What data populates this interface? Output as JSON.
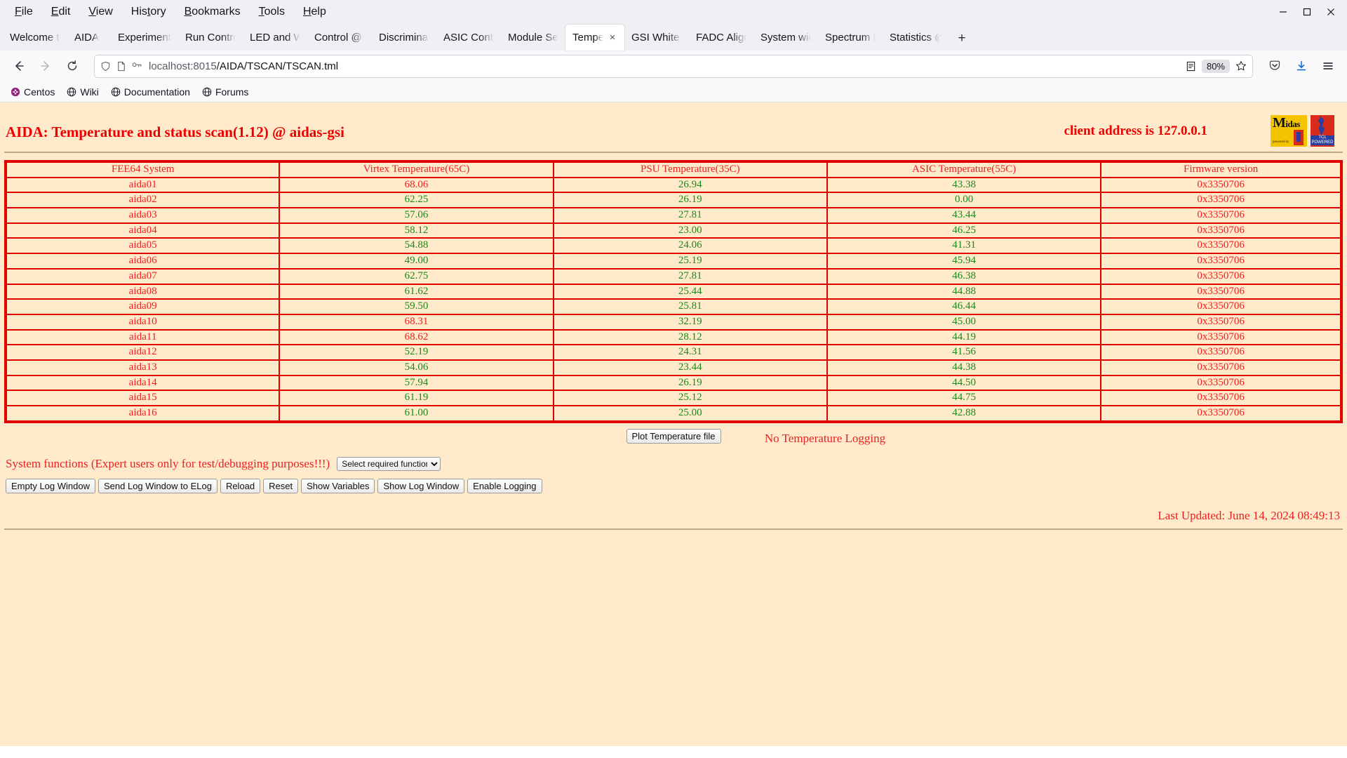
{
  "browser": {
    "menus": [
      "File",
      "Edit",
      "View",
      "History",
      "Bookmarks",
      "Tools",
      "Help"
    ],
    "window_controls": {
      "minimize": "—",
      "maximize": "☐",
      "close": "✕"
    },
    "tabs": [
      {
        "label": "Welcome to Cen",
        "active": false
      },
      {
        "label": "AIDA",
        "active": false
      },
      {
        "label": "Experiment Cont",
        "active": false
      },
      {
        "label": "Run Control @ a",
        "active": false
      },
      {
        "label": "LED and Wavefo",
        "active": false
      },
      {
        "label": "Control @ aidas",
        "active": false
      },
      {
        "label": "Discriminator co",
        "active": false
      },
      {
        "label": "ASIC Control @",
        "active": false
      },
      {
        "label": "Module Settings",
        "active": false
      },
      {
        "label": "Temperature a",
        "active": true
      },
      {
        "label": "GSI White Rabbi",
        "active": false
      },
      {
        "label": "FADC Align & Co",
        "active": false
      },
      {
        "label": "System wide Ch",
        "active": false
      },
      {
        "label": "Spectrum Brows",
        "active": false
      },
      {
        "label": "Statistics @ aid",
        "active": false
      }
    ],
    "new_tab_label": "+",
    "nav": {
      "back": "←",
      "forward": "→",
      "reload": "↻"
    },
    "url": {
      "host": "localhost:8015",
      "path": "/AIDA/TSCAN/TSCAN.tml"
    },
    "zoom_level": "80%",
    "bookmarks": [
      {
        "label": "Centos",
        "icon": "centos-icon"
      },
      {
        "label": "Wiki",
        "icon": "globe-icon"
      },
      {
        "label": "Documentation",
        "icon": "globe-icon"
      },
      {
        "label": "Forums",
        "icon": "globe-icon"
      }
    ]
  },
  "page": {
    "title": "AIDA: Temperature and status scan(1.12) @ aidas-gsi",
    "client_address": "client address is 127.0.0.1",
    "logos": {
      "midas": {
        "m": "M",
        "rest": "idas",
        "sub": "powered by"
      },
      "tcl": {
        "band": "TCL\nPOWERED",
        "line1": "TCL",
        "line2": "POWERED"
      }
    },
    "colors": {
      "background": "#ffeacb",
      "alert": "#ef2020",
      "ok": "#1a8a1a",
      "border": "#e00000"
    },
    "table": {
      "headers": [
        "FEE64 System",
        "Virtex Temperature(65C)",
        "PSU Temperature(35C)",
        "ASIC Temperature(55C)",
        "Firmware version"
      ],
      "rows": [
        {
          "system": "aida01",
          "virtex": "68.06",
          "virtex_hot": true,
          "psu": "26.94",
          "psu_hot": false,
          "asic": "43.38",
          "asic_hot": false,
          "firmware": "0x3350706"
        },
        {
          "system": "aida02",
          "virtex": "62.25",
          "virtex_hot": false,
          "psu": "26.19",
          "psu_hot": false,
          "asic": "0.00",
          "asic_hot": false,
          "firmware": "0x3350706"
        },
        {
          "system": "aida03",
          "virtex": "57.06",
          "virtex_hot": false,
          "psu": "27.81",
          "psu_hot": false,
          "asic": "43.44",
          "asic_hot": false,
          "firmware": "0x3350706"
        },
        {
          "system": "aida04",
          "virtex": "58.12",
          "virtex_hot": false,
          "psu": "23.00",
          "psu_hot": false,
          "asic": "46.25",
          "asic_hot": false,
          "firmware": "0x3350706"
        },
        {
          "system": "aida05",
          "virtex": "54.88",
          "virtex_hot": false,
          "psu": "24.06",
          "psu_hot": false,
          "asic": "41.31",
          "asic_hot": false,
          "firmware": "0x3350706"
        },
        {
          "system": "aida06",
          "virtex": "49.00",
          "virtex_hot": false,
          "psu": "25.19",
          "psu_hot": false,
          "asic": "45.94",
          "asic_hot": false,
          "firmware": "0x3350706"
        },
        {
          "system": "aida07",
          "virtex": "62.75",
          "virtex_hot": false,
          "psu": "27.81",
          "psu_hot": false,
          "asic": "46.38",
          "asic_hot": false,
          "firmware": "0x3350706"
        },
        {
          "system": "aida08",
          "virtex": "61.62",
          "virtex_hot": false,
          "psu": "25.44",
          "psu_hot": false,
          "asic": "44.88",
          "asic_hot": false,
          "firmware": "0x3350706"
        },
        {
          "system": "aida09",
          "virtex": "59.50",
          "virtex_hot": false,
          "psu": "25.81",
          "psu_hot": false,
          "asic": "46.44",
          "asic_hot": false,
          "firmware": "0x3350706"
        },
        {
          "system": "aida10",
          "virtex": "68.31",
          "virtex_hot": true,
          "psu": "32.19",
          "psu_hot": false,
          "asic": "45.00",
          "asic_hot": false,
          "firmware": "0x3350706"
        },
        {
          "system": "aida11",
          "virtex": "68.62",
          "virtex_hot": true,
          "psu": "28.12",
          "psu_hot": false,
          "asic": "44.19",
          "asic_hot": false,
          "firmware": "0x3350706"
        },
        {
          "system": "aida12",
          "virtex": "52.19",
          "virtex_hot": false,
          "psu": "24.31",
          "psu_hot": false,
          "asic": "41.56",
          "asic_hot": false,
          "firmware": "0x3350706"
        },
        {
          "system": "aida13",
          "virtex": "54.06",
          "virtex_hot": false,
          "psu": "23.44",
          "psu_hot": false,
          "asic": "44.38",
          "asic_hot": false,
          "firmware": "0x3350706"
        },
        {
          "system": "aida14",
          "virtex": "57.94",
          "virtex_hot": false,
          "psu": "26.19",
          "psu_hot": false,
          "asic": "44.50",
          "asic_hot": false,
          "firmware": "0x3350706"
        },
        {
          "system": "aida15",
          "virtex": "61.19",
          "virtex_hot": false,
          "psu": "25.12",
          "psu_hot": false,
          "asic": "44.75",
          "asic_hot": false,
          "firmware": "0x3350706"
        },
        {
          "system": "aida16",
          "virtex": "61.00",
          "virtex_hot": false,
          "psu": "25.00",
          "psu_hot": false,
          "asic": "42.88",
          "asic_hot": false,
          "firmware": "0x3350706"
        }
      ]
    },
    "plot_button": "Plot Temperature file",
    "logging_status": "No Temperature Logging",
    "system_functions_warning": "System functions (Expert users only for test/debugging purposes!!!)",
    "function_select": {
      "selected": "Select required function",
      "options": [
        "Select required function"
      ]
    },
    "action_buttons": [
      "Empty Log Window",
      "Send Log Window to ELog",
      "Reload",
      "Reset",
      "Show Variables",
      "Show Log Window",
      "Enable Logging"
    ],
    "last_updated": "Last Updated: June 14, 2024 08:49:13"
  }
}
